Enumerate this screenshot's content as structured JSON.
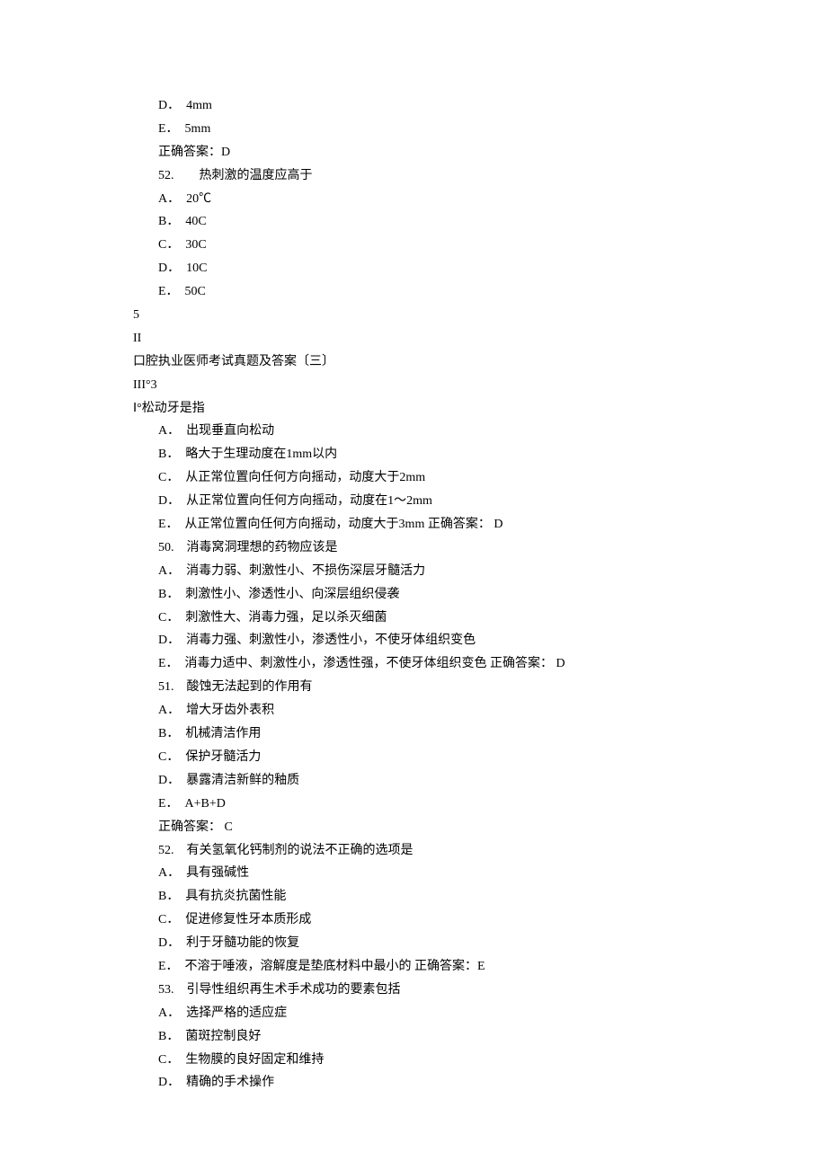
{
  "lines": [
    {
      "indent": true,
      "text": "D．　4mm"
    },
    {
      "indent": true,
      "text": "E．　5mm"
    },
    {
      "indent": true,
      "text": "正确答案：D"
    },
    {
      "indent": true,
      "text": "52.　　热刺激的温度应高于"
    },
    {
      "indent": true,
      "text": "A．　20℃"
    },
    {
      "indent": true,
      "text": "B．　40C"
    },
    {
      "indent": true,
      "text": "C．　30C"
    },
    {
      "indent": true,
      "text": "D．　10C"
    },
    {
      "indent": true,
      "text": "E．　50C"
    },
    {
      "indent": false,
      "text": "5"
    },
    {
      "indent": false,
      "text": ""
    },
    {
      "indent": false,
      "text": "II"
    },
    {
      "indent": false,
      "text": ""
    },
    {
      "indent": false,
      "text": "口腔执业医师考试真题及答案〔三〕"
    },
    {
      "indent": false,
      "text": ""
    },
    {
      "indent": false,
      "text": "III°3"
    },
    {
      "indent": false,
      "text": "Ⅰ°松动牙是指"
    },
    {
      "indent": true,
      "text": "A．　出现垂直向松动"
    },
    {
      "indent": true,
      "text": "B．　略大于生理动度在1mm以内"
    },
    {
      "indent": true,
      "text": "C．　从正常位置向任何方向摇动，动度大于2mm"
    },
    {
      "indent": true,
      "text": "D．　从正常位置向任何方向摇动，动度在1～2mm"
    },
    {
      "indent": true,
      "text": "E．　从正常位置向任何方向摇动，动度大于3mm 正确答案： D"
    },
    {
      "indent": true,
      "text": "50.　消毒窝洞理想的药物应该是"
    },
    {
      "indent": true,
      "text": "A．　消毒力弱、刺激性小、不损伤深层牙髓活力"
    },
    {
      "indent": true,
      "text": "B．　刺激性小、渗透性小、向深层组织侵袭"
    },
    {
      "indent": true,
      "text": "C．　刺激性大、消毒力强，足以杀灭细菌"
    },
    {
      "indent": true,
      "text": "D．　消毒力强、刺激性小，渗透性小，不使牙体组织变色"
    },
    {
      "indent": true,
      "text": "E．　消毒力适中、刺激性小，渗透性强，不使牙体组织变色 正确答案： D"
    },
    {
      "indent": true,
      "text": "51.　酸蚀无法起到的作用有"
    },
    {
      "indent": true,
      "text": "A．　增大牙齿外表积"
    },
    {
      "indent": true,
      "text": "B．　机械清洁作用"
    },
    {
      "indent": true,
      "text": "C．　保护牙髓活力"
    },
    {
      "indent": true,
      "text": "D．　暴露清洁新鲜的釉质"
    },
    {
      "indent": true,
      "text": "E．　A+B+D"
    },
    {
      "indent": true,
      "text": "正确答案： C"
    },
    {
      "indent": true,
      "text": "52.　有关氢氧化钙制剂的说法不正确的选项是"
    },
    {
      "indent": true,
      "text": "A．　具有强碱性"
    },
    {
      "indent": true,
      "text": "B．　具有抗炎抗菌性能"
    },
    {
      "indent": true,
      "text": "C．　促进修复性牙本质形成"
    },
    {
      "indent": true,
      "text": "D．　利于牙髓功能的恢复"
    },
    {
      "indent": true,
      "text": "E．　不溶于唾液，溶解度是垫底材料中最小的 正确答案：E"
    },
    {
      "indent": true,
      "text": "53.　引导性组织再生术手术成功的要素包括"
    },
    {
      "indent": true,
      "text": "A．　选择严格的适应症"
    },
    {
      "indent": true,
      "text": "B．　菌斑控制良好"
    },
    {
      "indent": true,
      "text": "C．　生物膜的良好固定和维持"
    },
    {
      "indent": true,
      "text": "D．　精确的手术操作"
    }
  ]
}
